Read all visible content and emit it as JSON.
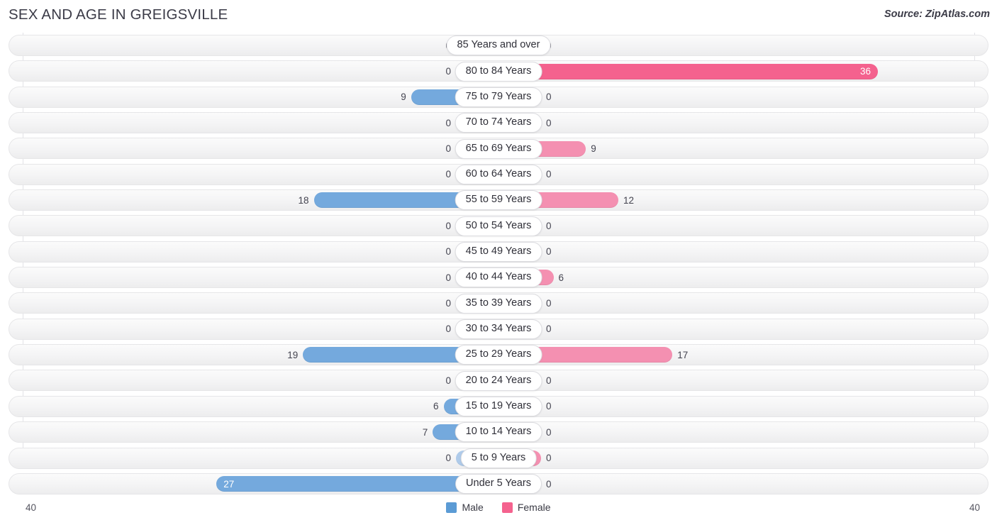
{
  "header": {
    "title": "SEX AND AGE IN GREIGSVILLE",
    "source": "Source: ZipAtlas.com"
  },
  "legend": {
    "male_label": "Male",
    "female_label": "Female",
    "male_color": "#5b9bd5",
    "female_color": "#f4628e"
  },
  "axis": {
    "left_tick": "40",
    "right_tick": "40"
  },
  "colors": {
    "male_bar": "#74a9dd",
    "male_zero": "#afcbea",
    "female_bar": "#f490b1",
    "female_strong": "#f4628e",
    "track": "#f4f4f5"
  },
  "chart_data": {
    "type": "bar",
    "subtype": "population-pyramid",
    "title": "SEX AND AGE IN GREIGSVILLE",
    "xlabel": "",
    "ylabel": "",
    "xlim": [
      40,
      40
    ],
    "axis_max": 40,
    "grid": true,
    "legend_position": "bottom-center",
    "categories": [
      "85 Years and over",
      "80 to 84 Years",
      "75 to 79 Years",
      "70 to 74 Years",
      "65 to 69 Years",
      "60 to 64 Years",
      "55 to 59 Years",
      "50 to 54 Years",
      "45 to 49 Years",
      "40 to 44 Years",
      "35 to 39 Years",
      "30 to 34 Years",
      "25 to 29 Years",
      "20 to 24 Years",
      "15 to 19 Years",
      "10 to 14 Years",
      "5 to 9 Years",
      "Under 5 Years"
    ],
    "series": [
      {
        "name": "Male",
        "color": "#74a9dd",
        "values": [
          0,
          0,
          9,
          0,
          0,
          0,
          18,
          0,
          0,
          0,
          0,
          0,
          19,
          0,
          6,
          7,
          0,
          27
        ]
      },
      {
        "name": "Female",
        "color": "#f490b1",
        "values": [
          0,
          36,
          0,
          0,
          9,
          0,
          12,
          0,
          0,
          6,
          0,
          0,
          17,
          0,
          0,
          0,
          0,
          0
        ]
      }
    ]
  },
  "rows": [
    {
      "age": "85 Years and over",
      "male": "0",
      "female": "0"
    },
    {
      "age": "80 to 84 Years",
      "male": "0",
      "female": "36"
    },
    {
      "age": "75 to 79 Years",
      "male": "9",
      "female": "0"
    },
    {
      "age": "70 to 74 Years",
      "male": "0",
      "female": "0"
    },
    {
      "age": "65 to 69 Years",
      "male": "0",
      "female": "9"
    },
    {
      "age": "60 to 64 Years",
      "male": "0",
      "female": "0"
    },
    {
      "age": "55 to 59 Years",
      "male": "18",
      "female": "12"
    },
    {
      "age": "50 to 54 Years",
      "male": "0",
      "female": "0"
    },
    {
      "age": "45 to 49 Years",
      "male": "0",
      "female": "0"
    },
    {
      "age": "40 to 44 Years",
      "male": "0",
      "female": "6"
    },
    {
      "age": "35 to 39 Years",
      "male": "0",
      "female": "0"
    },
    {
      "age": "30 to 34 Years",
      "male": "0",
      "female": "0"
    },
    {
      "age": "25 to 29 Years",
      "male": "19",
      "female": "17"
    },
    {
      "age": "20 to 24 Years",
      "male": "0",
      "female": "0"
    },
    {
      "age": "15 to 19 Years",
      "male": "6",
      "female": "0"
    },
    {
      "age": "10 to 14 Years",
      "male": "7",
      "female": "0"
    },
    {
      "age": "5 to 9 Years",
      "male": "0",
      "female": "0"
    },
    {
      "age": "Under 5 Years",
      "male": "27",
      "female": "0"
    }
  ]
}
